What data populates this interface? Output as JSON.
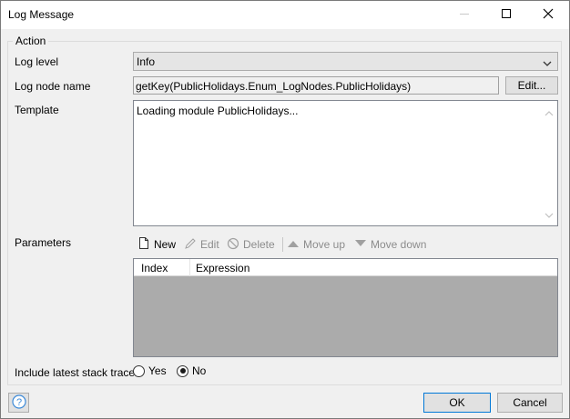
{
  "window": {
    "title": "Log Message",
    "icons": [
      "minimize-icon",
      "maximize-icon",
      "close-icon"
    ]
  },
  "action_group": {
    "legend": "Action",
    "log_level": {
      "label": "Log level",
      "value": "Info"
    },
    "log_node_name": {
      "label": "Log node name",
      "value": "getKey(PublicHolidays.Enum_LogNodes.PublicHolidays)",
      "edit_label": "Edit..."
    },
    "template": {
      "label": "Template",
      "value": "Loading module PublicHolidays..."
    },
    "parameters": {
      "label": "Parameters",
      "toolbar": {
        "new": "New",
        "edit": "Edit",
        "delete": "Delete",
        "move_up": "Move up",
        "move_down": "Move down"
      },
      "columns": [
        "Index",
        "Expression"
      ],
      "rows": []
    },
    "stack_trace": {
      "label": "Include latest stack trace",
      "options": [
        "Yes",
        "No"
      ],
      "selected": "No"
    }
  },
  "footer": {
    "ok": "OK",
    "cancel": "Cancel"
  },
  "colors": {
    "accent": "#0078d7",
    "grid_empty": "#ababab",
    "help_icon": "#3c8ad8"
  }
}
